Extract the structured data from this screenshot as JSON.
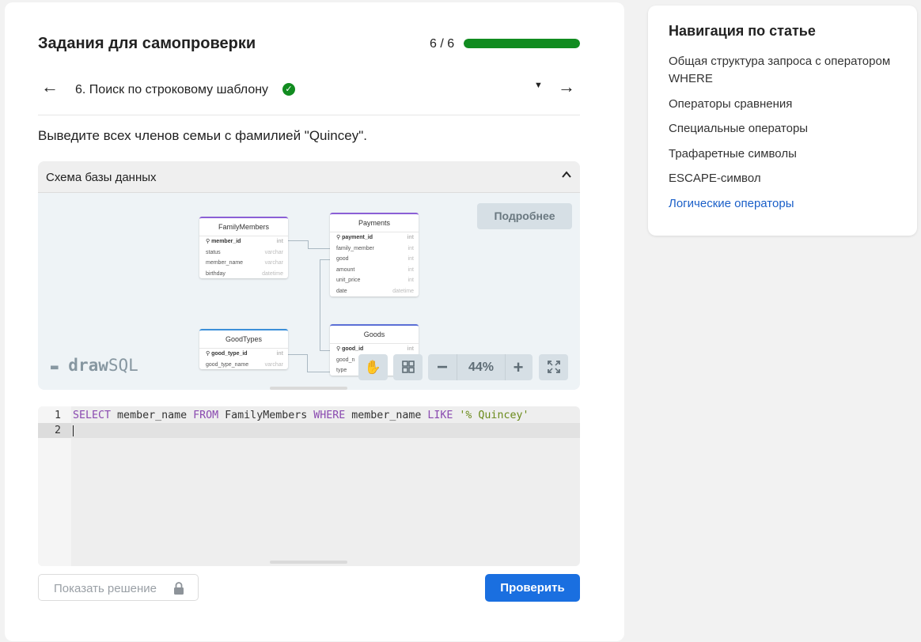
{
  "task": {
    "title": "Задания для самопроверки",
    "progress_text": "6 / 6",
    "progress_fraction": 1.0,
    "current_task": "6. Поиск по строковому шаблону",
    "description": "Выведите всех членов семьи с фамилией \"Quincey\"."
  },
  "schema": {
    "title": "Схема базы данных",
    "more_button": "Подробнее",
    "zoom": "44%",
    "logo": {
      "bold": "draw",
      "light": "SQL"
    },
    "tables": {
      "family_members": {
        "name": "FamilyMembers",
        "rows": [
          {
            "col": "member_id",
            "type": "int"
          },
          {
            "col": "status",
            "type": "varchar"
          },
          {
            "col": "member_name",
            "type": "varchar"
          },
          {
            "col": "birthday",
            "type": "datetime"
          }
        ]
      },
      "payments": {
        "name": "Payments",
        "rows": [
          {
            "col": "payment_id",
            "type": "int"
          },
          {
            "col": "family_member",
            "type": "int"
          },
          {
            "col": "good",
            "type": "int"
          },
          {
            "col": "amount",
            "type": "int"
          },
          {
            "col": "unit_price",
            "type": "int"
          },
          {
            "col": "date",
            "type": "datetime"
          }
        ]
      },
      "good_types": {
        "name": "GoodTypes",
        "rows": [
          {
            "col": "good_type_id",
            "type": "int"
          },
          {
            "col": "good_type_name",
            "type": "varchar"
          }
        ]
      },
      "goods": {
        "name": "Goods",
        "rows": [
          {
            "col": "good_id",
            "type": "int"
          },
          {
            "col": "good_n",
            "type": ""
          },
          {
            "col": "type",
            "type": ""
          }
        ]
      }
    }
  },
  "editor": {
    "lines": [
      {
        "num": "1",
        "tokens": [
          "SELECT",
          " member_name ",
          "FROM",
          " FamilyMembers ",
          "WHERE",
          " member_name ",
          "LIKE",
          " ",
          "'% Quincey'"
        ]
      },
      {
        "num": "2",
        "tokens": []
      }
    ]
  },
  "actions": {
    "show_solution": "Показать решение",
    "check": "Проверить"
  },
  "nav": {
    "title": "Навигация по статье",
    "items": [
      "Общая структура запроса с оператором WHERE",
      "Операторы сравнения",
      "Специальные операторы",
      "Трафаретные символы",
      "ESCAPE-символ",
      "Логические операторы"
    ]
  },
  "colors": {
    "progress": "#118c20",
    "accent": "#1a6fe0",
    "nav_current": "#1a5fc8",
    "keyword": "#8a4ab0",
    "string": "#6a8a1a"
  }
}
